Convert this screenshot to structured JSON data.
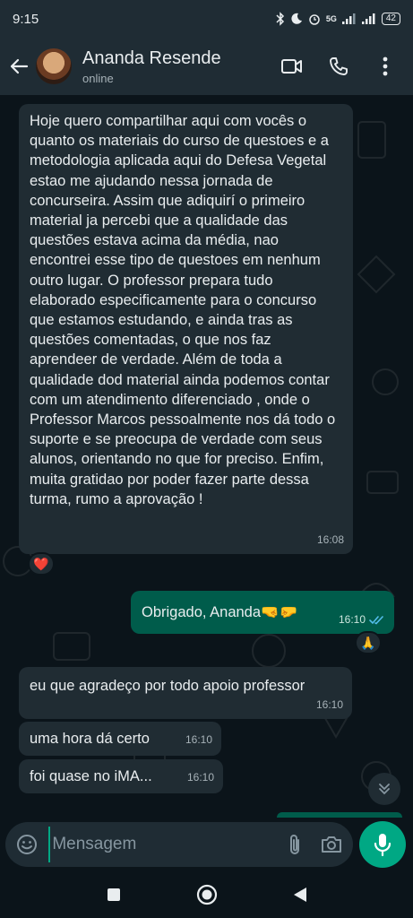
{
  "status_bar": {
    "time": "9:15",
    "network": "5G",
    "battery": "42"
  },
  "header": {
    "name": "Ananda Resende",
    "status": "online"
  },
  "messages": [
    {
      "dir": "in",
      "text": "Hoje quero compartilhar aqui com  vocês o quanto os materiais do curso de questoes e a metodologia aplicada aqui do Defesa Vegetal estao me ajudando nessa jornada de concurseira. Assim que adiquirí o primeiro material ja percebi que a qualidade das questões estava acima da média, nao encontrei esse tipo de questoes em nenhum outro lugar. O professor prepara tudo elaborado especificamente para o concurso que estamos estudando, e ainda tras as questões comentadas, o que nos faz aprendeer de verdade. Além de toda a qualidade dod material ainda podemos contar com um atendimento diferenciado , onde o Professor Marcos pessoalmente nos dá todo o suporte e se preocupa de verdade com seus alunos, orientando no que for preciso. Enfim, muita gratidao por poder fazer parte dessa turma, rumo a aprovação !",
      "time": "16:08",
      "reaction": "❤️"
    },
    {
      "dir": "out",
      "text": "Obrigado, Ananda🤜🤛",
      "time": "16:10",
      "reaction": "🙏"
    },
    {
      "dir": "in",
      "text": "eu que agradeço por todo apoio professor",
      "time": "16:10"
    },
    {
      "dir": "in",
      "text": "uma hora dá certo",
      "time": "16:10"
    },
    {
      "dir": "in",
      "text": "foi quase no iMA...",
      "time": "16:10"
    }
  ],
  "composer": {
    "placeholder": "Mensagem"
  },
  "colors": {
    "incoming": "#202c33",
    "outgoing": "#005c4b",
    "accent": "#00a884",
    "read_ticks": "#53bdeb"
  },
  "icons": [
    "back-arrow-icon",
    "video-call-icon",
    "phone-icon",
    "more-options-icon",
    "emoji-icon",
    "attach-icon",
    "camera-icon",
    "mic-icon",
    "scroll-down-icon",
    "recents-icon",
    "home-icon",
    "back-nav-icon"
  ]
}
